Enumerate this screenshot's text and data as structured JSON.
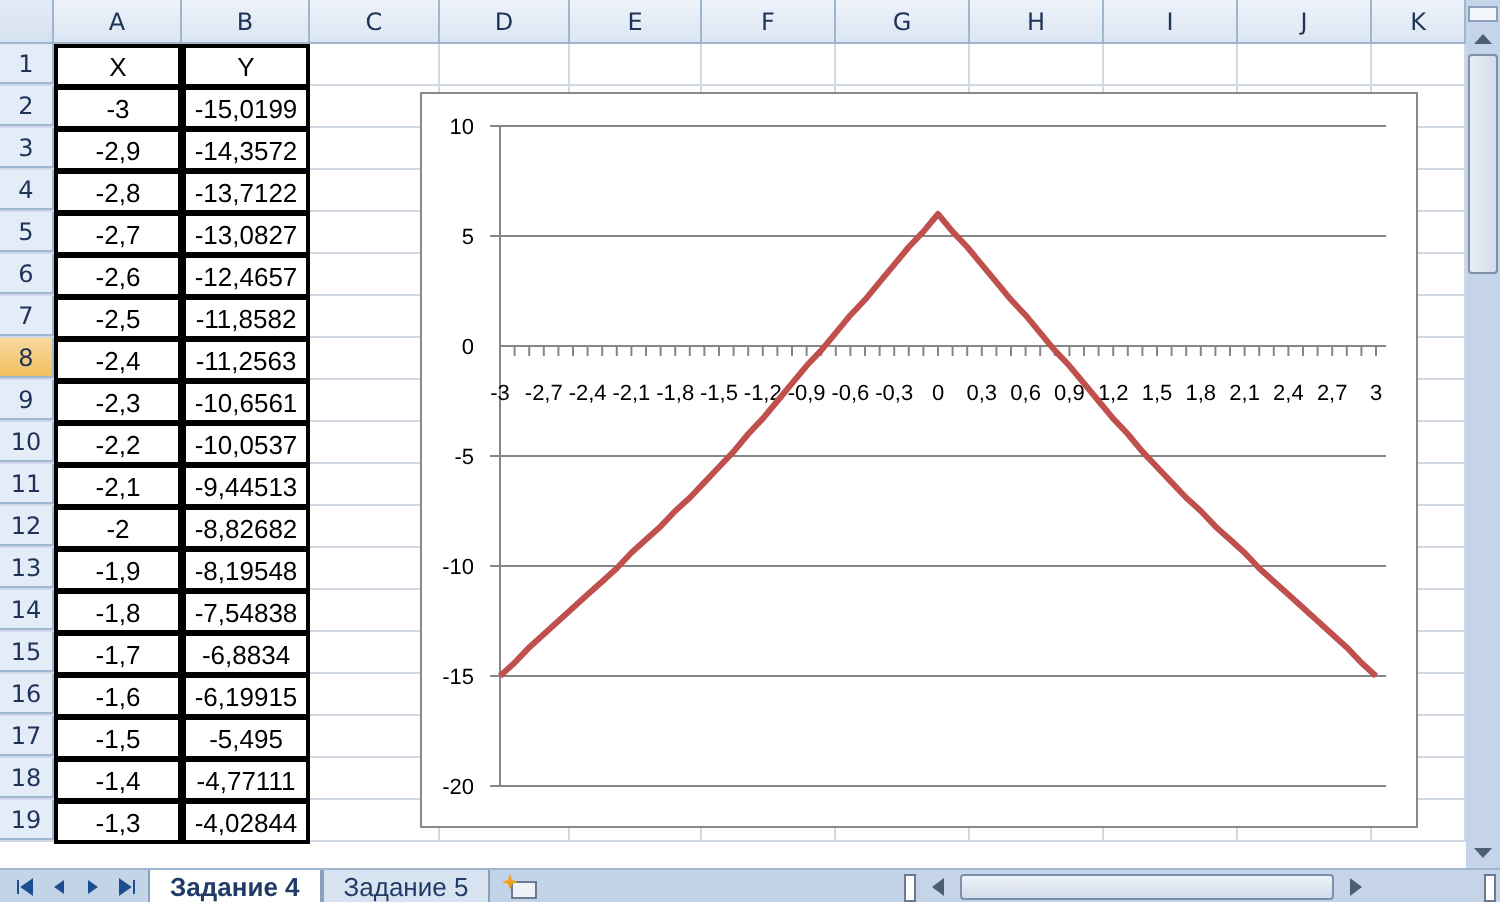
{
  "columns": [
    "A",
    "B",
    "C",
    "D",
    "E",
    "F",
    "G",
    "H",
    "I",
    "J",
    "K"
  ],
  "rows": [
    {
      "num": "1",
      "selected": false,
      "cells": [
        "X",
        "Y"
      ]
    },
    {
      "num": "2",
      "selected": false,
      "cells": [
        "-3",
        "-15,0199"
      ]
    },
    {
      "num": "3",
      "selected": false,
      "cells": [
        "-2,9",
        "-14,3572"
      ]
    },
    {
      "num": "4",
      "selected": false,
      "cells": [
        "-2,8",
        "-13,7122"
      ]
    },
    {
      "num": "5",
      "selected": false,
      "cells": [
        "-2,7",
        "-13,0827"
      ]
    },
    {
      "num": "6",
      "selected": false,
      "cells": [
        "-2,6",
        "-12,4657"
      ]
    },
    {
      "num": "7",
      "selected": false,
      "cells": [
        "-2,5",
        "-11,8582"
      ]
    },
    {
      "num": "8",
      "selected": true,
      "cells": [
        "-2,4",
        "-11,2563"
      ]
    },
    {
      "num": "9",
      "selected": false,
      "cells": [
        "-2,3",
        "-10,6561"
      ]
    },
    {
      "num": "10",
      "selected": false,
      "cells": [
        "-2,2",
        "-10,0537"
      ]
    },
    {
      "num": "11",
      "selected": false,
      "cells": [
        "-2,1",
        "-9,44513"
      ]
    },
    {
      "num": "12",
      "selected": false,
      "cells": [
        "-2",
        "-8,82682"
      ]
    },
    {
      "num": "13",
      "selected": false,
      "cells": [
        "-1,9",
        "-8,19548"
      ]
    },
    {
      "num": "14",
      "selected": false,
      "cells": [
        "-1,8",
        "-7,54838"
      ]
    },
    {
      "num": "15",
      "selected": false,
      "cells": [
        "-1,7",
        "-6,8834"
      ]
    },
    {
      "num": "16",
      "selected": false,
      "cells": [
        "-1,6",
        "-6,19915"
      ]
    },
    {
      "num": "17",
      "selected": false,
      "cells": [
        "-1,5",
        "-5,495"
      ]
    },
    {
      "num": "18",
      "selected": false,
      "cells": [
        "-1,4",
        "-4,77111"
      ]
    },
    {
      "num": "19",
      "selected": false,
      "cells": [
        "-1,3",
        "-4,02844"
      ]
    }
  ],
  "chart": {
    "chart_data": {
      "type": "line",
      "x": [
        -3,
        -2.9,
        -2.8,
        -2.7,
        -2.6,
        -2.5,
        -2.4,
        -2.3,
        -2.2,
        -2.1,
        -2,
        -1.9,
        -1.8,
        -1.7,
        -1.6,
        -1.5,
        -1.4,
        -1.3,
        -1.2,
        -1.1,
        -1,
        -0.9,
        -0.8,
        -0.7,
        -0.6,
        -0.5,
        -0.4,
        -0.3,
        -0.2,
        -0.1,
        0,
        0.1,
        0.2,
        0.3,
        0.4,
        0.5,
        0.6,
        0.7,
        0.8,
        0.9,
        1,
        1.1,
        1.2,
        1.3,
        1.4,
        1.5,
        1.6,
        1.7,
        1.8,
        1.9,
        2,
        2.1,
        2.2,
        2.3,
        2.4,
        2.5,
        2.6,
        2.7,
        2.8,
        2.9,
        3
      ],
      "series": [
        {
          "color": "#c0504d",
          "values": [
            -15,
            -14.4,
            -13.7,
            -13.1,
            -12.5,
            -11.9,
            -11.3,
            -10.7,
            -10.1,
            -9.4,
            -8.8,
            -8.2,
            -7.5,
            -6.9,
            -6.2,
            -5.5,
            -4.8,
            -4,
            -3.3,
            -2.5,
            -1.7,
            -0.9,
            -0.2,
            0.6,
            1.4,
            2.1,
            2.9,
            3.7,
            4.5,
            5.2,
            6,
            5.2,
            4.5,
            3.7,
            2.9,
            2.1,
            1.4,
            0.6,
            -0.2,
            -0.9,
            -1.7,
            -2.5,
            -3.3,
            -4,
            -4.8,
            -5.5,
            -6.2,
            -6.9,
            -7.5,
            -8.2,
            -8.8,
            -9.4,
            -10.1,
            -10.7,
            -11.3,
            -11.9,
            -12.5,
            -13.1,
            -13.7,
            -14.4,
            -15
          ]
        }
      ],
      "xlim": [
        -3,
        3
      ],
      "ylim": [
        -20,
        10
      ],
      "grid": true,
      "yticks": [
        10,
        5,
        0,
        -5,
        -10,
        -15,
        -20
      ],
      "xticks": [
        {
          "value": -3,
          "label": "-3"
        },
        {
          "value": -2.7,
          "label": "-2,7"
        },
        {
          "value": -2.4,
          "label": "-2,4"
        },
        {
          "value": -2.1,
          "label": "-2,1"
        },
        {
          "value": -1.8,
          "label": "-1,8"
        },
        {
          "value": -1.5,
          "label": "-1,5"
        },
        {
          "value": -1.2,
          "label": "-1,2"
        },
        {
          "value": -0.9,
          "label": "-0,9"
        },
        {
          "value": -0.6,
          "label": "-0,6"
        },
        {
          "value": -0.3,
          "label": "-0,3"
        },
        {
          "value": 0,
          "label": "0"
        },
        {
          "value": 0.3,
          "label": "0,3"
        },
        {
          "value": 0.6,
          "label": "0,6"
        },
        {
          "value": 0.9,
          "label": "0,9"
        },
        {
          "value": 1.2,
          "label": "1,2"
        },
        {
          "value": 1.5,
          "label": "1,5"
        },
        {
          "value": 1.8,
          "label": "1,8"
        },
        {
          "value": 2.1,
          "label": "2,1"
        },
        {
          "value": 2.4,
          "label": "2,4"
        },
        {
          "value": 2.7,
          "label": "2,7"
        },
        {
          "value": 3,
          "label": "3"
        }
      ]
    }
  },
  "sheet_tabs": [
    {
      "label": "Задание 4",
      "selected": true
    },
    {
      "label": "Задание 5",
      "selected": false
    }
  ]
}
